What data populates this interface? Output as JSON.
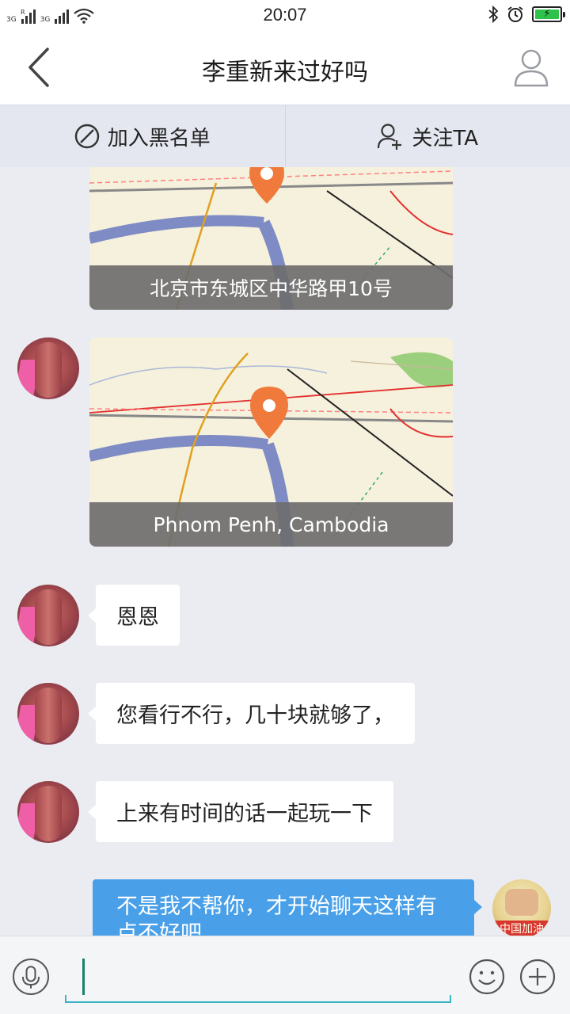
{
  "status_bar": {
    "net1": "3G",
    "net1_roaming": "R",
    "net2": "3G",
    "time": "20:07",
    "icons": [
      "bluetooth-icon",
      "alarm-icon",
      "battery-charging-icon"
    ]
  },
  "header": {
    "title": "李重新来过好吗",
    "back_icon": "chevron-left-icon",
    "profile_icon": "user-icon"
  },
  "actions": {
    "blacklist_label": "加入黑名单",
    "blacklist_icon": "block-icon",
    "follow_label": "关注TA",
    "follow_icon": "add-user-icon"
  },
  "messages": [
    {
      "type": "location",
      "sender": "other",
      "caption": "北京市东城区中华路甲10号"
    },
    {
      "type": "location",
      "sender": "other",
      "caption": "Phnom Penh, Cambodia"
    },
    {
      "type": "text",
      "sender": "other",
      "text": "恩恩"
    },
    {
      "type": "text",
      "sender": "other",
      "text": "您看行不行，几十块就够了，"
    },
    {
      "type": "text",
      "sender": "other",
      "text": "上来有时间的话一起玩一下"
    },
    {
      "type": "text",
      "sender": "me",
      "text": "不是我不帮你，才开始聊天这样有点不好吧"
    }
  ],
  "my_avatar_text": "中国加油",
  "input_bar": {
    "value": "",
    "voice_icon": "microphone-icon",
    "emoji_icon": "smiley-icon",
    "more_icon": "plus-circle-icon"
  },
  "colors": {
    "accent": "#49a0e8",
    "background": "#ebecf1",
    "input_underline": "#3cb4c6",
    "map_pin": "#f07a3c"
  }
}
